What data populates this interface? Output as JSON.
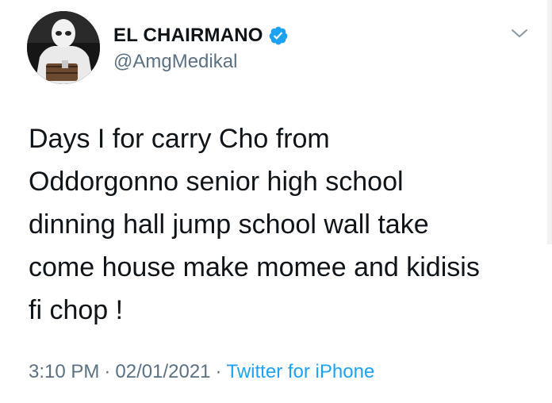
{
  "tweet": {
    "display_name": "EL CHAIRMANO",
    "handle": "@AmgMedikal",
    "verified": true,
    "text": "Days I for carry Cho from\nOddorgonno senior high school\ndinning hall jump school wall take\ncome house make momee and kidisis\nfi chop !",
    "time": "3:10 PM",
    "date": "02/01/2021",
    "separator": "·",
    "source": "Twitter for iPhone"
  },
  "icons": {
    "verified": "verified-badge-icon",
    "menu": "chevron-down-icon"
  },
  "colors": {
    "text": "#0f1419",
    "secondary": "#5b7083",
    "accent": "#1da1f2"
  }
}
